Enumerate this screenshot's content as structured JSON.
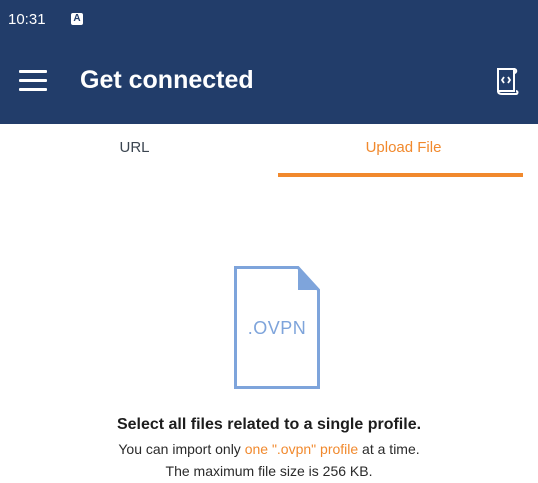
{
  "status_bar": {
    "time": "10:31",
    "notification_icon": "a-badge-icon",
    "notification_letter": "A"
  },
  "app_bar": {
    "title": "Get connected",
    "menu_icon": "hamburger-menu-icon",
    "action_icon": "ovpn-profile-icon"
  },
  "tabs": [
    {
      "label": "URL",
      "selected": false
    },
    {
      "label": "Upload File",
      "selected": true
    }
  ],
  "upload": {
    "file_label": ".OVPN",
    "headline": "Select all files related to a single profile.",
    "info_prefix": "You can import only ",
    "info_link": "one \".ovpn\" profile",
    "info_suffix": " at a time.",
    "size_note": "The maximum file size is 256 KB."
  },
  "colors": {
    "primary": "#223d6a",
    "accent": "#f1892d",
    "file_icon": "#7ea4db"
  }
}
